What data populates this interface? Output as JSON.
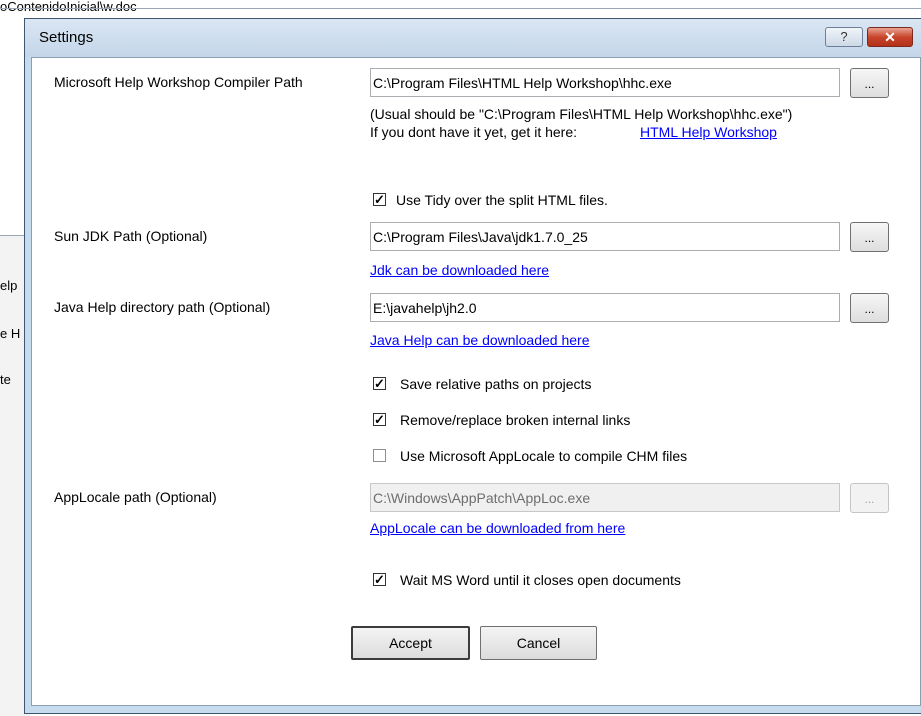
{
  "background": {
    "title_fragment": "oContenidoInicial\\w.doc",
    "frag1": "elp",
    "frag2": "e H",
    "frag3": "te"
  },
  "dialog": {
    "title": "Settings",
    "help_label": "?",
    "close_label": "✕"
  },
  "compiler": {
    "label": "Microsoft Help Workshop Compiler Path",
    "value": "C:\\Program Files\\HTML Help Workshop\\hhc.exe",
    "browse_label": "...",
    "hint_line1": "(Usual should be \"C:\\Program Files\\HTML Help Workshop\\hhc.exe\")",
    "hint_line2": "If you dont have it yet, get it here:",
    "link": "HTML Help Workshop"
  },
  "tidy": {
    "label": "Use Tidy over the split HTML files.",
    "checked": true
  },
  "jdk": {
    "label": "Sun JDK Path (Optional)",
    "value": "C:\\Program Files\\Java\\jdk1.7.0_25",
    "browse_label": "...",
    "link": "Jdk can be downloaded here"
  },
  "javahelp": {
    "label": "Java Help directory path (Optional)",
    "value": "E:\\javahelp\\jh2.0",
    "browse_label": "...",
    "link": "Java Help can be downloaded here"
  },
  "options": {
    "relative_paths": {
      "label": "Save relative paths on projects",
      "checked": true
    },
    "broken_links": {
      "label": "Remove/replace broken internal links",
      "checked": true
    },
    "applocale": {
      "label": "Use Microsoft AppLocale to compile CHM files",
      "checked": false
    }
  },
  "applocale_path": {
    "label": "AppLocale path (Optional)",
    "value": "C:\\Windows\\AppPatch\\AppLoc.exe",
    "browse_label": "...",
    "link": "AppLocale can be downloaded from here"
  },
  "wait_word": {
    "label": "Wait MS Word until it closes open documents",
    "checked": true
  },
  "buttons": {
    "accept": "Accept",
    "cancel": "Cancel"
  },
  "colors": {
    "link": "#0000ff",
    "title_bar": "#c7dbee",
    "close_button": "#c8452c"
  }
}
